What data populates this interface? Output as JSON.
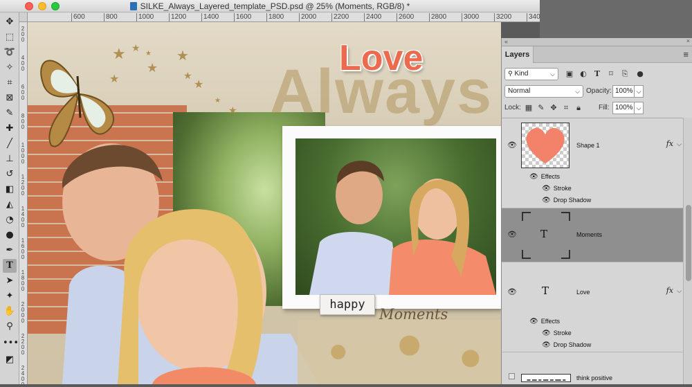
{
  "window": {
    "title": "SILKE_Always_Layered_template_PSD.psd @ 25% (Moments, RGB/8) *"
  },
  "ruler": {
    "top_ticks": [
      "600",
      "800",
      "1000",
      "1200",
      "1400",
      "1600",
      "1800",
      "2000",
      "2200",
      "2400",
      "2600",
      "2800",
      "3000",
      "3200",
      "3400"
    ],
    "left_ticks": [
      "200",
      "400",
      "600",
      "800",
      "1000",
      "1200",
      "1400",
      "1600",
      "1800",
      "2000",
      "2200",
      "2400"
    ]
  },
  "toolbar": {
    "tools": [
      "move-tool",
      "marquee-tool",
      "lasso-tool",
      "magic-wand-tool",
      "crop-tool",
      "frame-tool",
      "eyedropper-tool",
      "spot-healing-tool",
      "brush-tool",
      "clone-stamp-tool",
      "history-brush-tool",
      "eraser-tool",
      "paint-bucket-tool",
      "blur-tool",
      "dodge-tool",
      "pen-tool",
      "type-tool",
      "path-selection-tool",
      "custom-shape-tool",
      "hand-tool",
      "zoom-tool",
      "more-tools",
      "default-colors"
    ],
    "active_tool": "type-tool"
  },
  "canvas": {
    "love_text": "Love",
    "always_text": "Always",
    "happy_text": "happy",
    "moments_text": "Moments",
    "colors": {
      "love": "#ec6b4f",
      "always": "#b0965f"
    }
  },
  "layers_panel": {
    "tab_label": "Layers",
    "kind_label": "Kind",
    "blend_mode": "Normal",
    "opacity_label": "Opacity:",
    "opacity_value": "100%",
    "lock_label": "Lock:",
    "fill_label": "Fill:",
    "fill_value": "100%",
    "layers": [
      {
        "name": "Shape 1",
        "thumb": "heart-shape",
        "fx": "fx",
        "effects_label": "Effects",
        "effects": [
          "Stroke",
          "Drop Shadow"
        ],
        "selected": false
      },
      {
        "name": "Moments",
        "thumb": "type-layer",
        "thumb_glyph": "T",
        "selected": true
      },
      {
        "name": "Love",
        "thumb": "type-layer",
        "thumb_glyph": "T",
        "fx": "fx",
        "effects_label": "Effects",
        "effects": [
          "Stroke",
          "Drop Shadow"
        ],
        "selected": false
      },
      {
        "name": "think positive",
        "thumb": "text-strip",
        "selected": false
      }
    ],
    "selected_row_color": "#8f8f8f"
  }
}
